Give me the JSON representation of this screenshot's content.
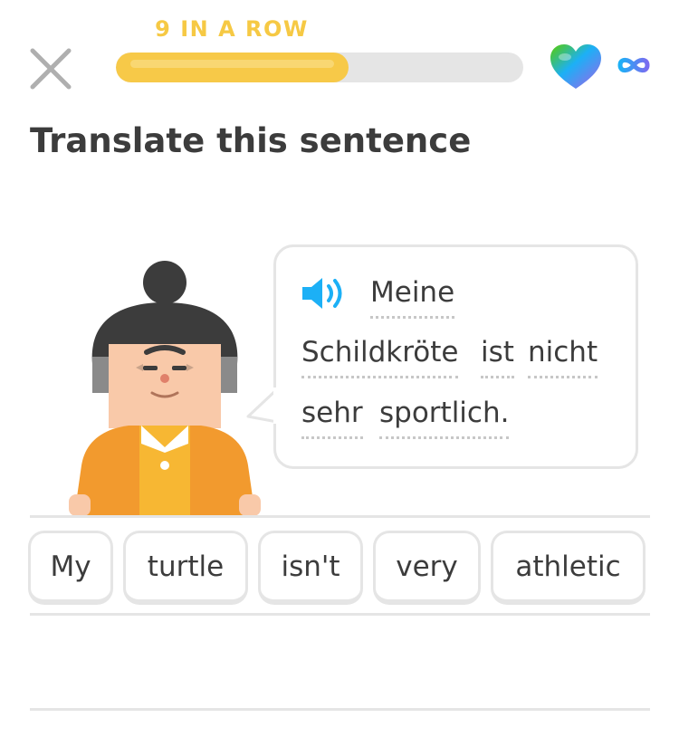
{
  "header": {
    "streak_label": "9 IN A ROW",
    "progress": 0.57,
    "hearts": "∞"
  },
  "prompt": {
    "title": "Translate this sentence"
  },
  "sentence": {
    "words": [
      "Meine",
      "Schildkröte",
      "ist",
      "nicht",
      "sehr",
      "sportlich."
    ]
  },
  "word_bank": {
    "words": [
      "My",
      "turtle",
      "isn't",
      "very",
      "athletic"
    ]
  },
  "colors": {
    "accent": "#f7c948",
    "track": "#e5e5e5",
    "speaker": "#1cb0f6",
    "text": "#3c3c3c"
  },
  "icons": {
    "close": "close-icon",
    "heart": "heart-icon",
    "infinity": "infinity-icon",
    "speaker": "speaker-icon"
  }
}
